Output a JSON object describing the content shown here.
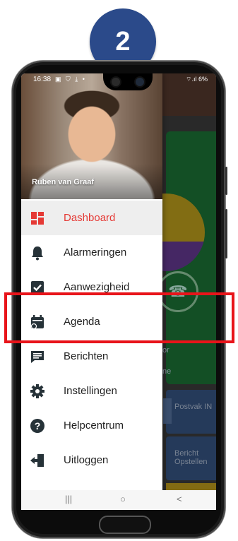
{
  "step_badge": "2",
  "status_bar": {
    "time": "16:38",
    "icons": "▣ ⛉ ⤓ •",
    "right": "⌔.ıl 6%"
  },
  "profile": {
    "name": "Ruben van Graaf"
  },
  "menu": [
    {
      "label": "Dashboard",
      "icon": "dashboard-icon",
      "active": true
    },
    {
      "label": "Alarmeringen",
      "icon": "bell-icon",
      "active": false
    },
    {
      "label": "Aanwezigheid",
      "icon": "checkbox-icon",
      "active": false
    },
    {
      "label": "Agenda",
      "icon": "calendar-icon",
      "active": false
    },
    {
      "label": "Berichten",
      "icon": "message-icon",
      "active": false
    },
    {
      "label": "Instellingen",
      "icon": "gear-icon",
      "active": false
    },
    {
      "label": "Helpcentrum",
      "icon": "help-icon",
      "active": false
    },
    {
      "label": "Uitloggen",
      "icon": "logout-icon",
      "active": false
    }
  ],
  "background_app": {
    "tile_1": "Postvak IN",
    "tile_2": "Bericht Opstellen",
    "text_1": "or",
    "text_2": "ne"
  },
  "nav": {
    "recent": "|||",
    "home": "○",
    "back": "<"
  },
  "colors": {
    "accent": "#e53935",
    "icon": "#263238",
    "highlight": "#e8141a",
    "badge": "#2b4a8a"
  }
}
